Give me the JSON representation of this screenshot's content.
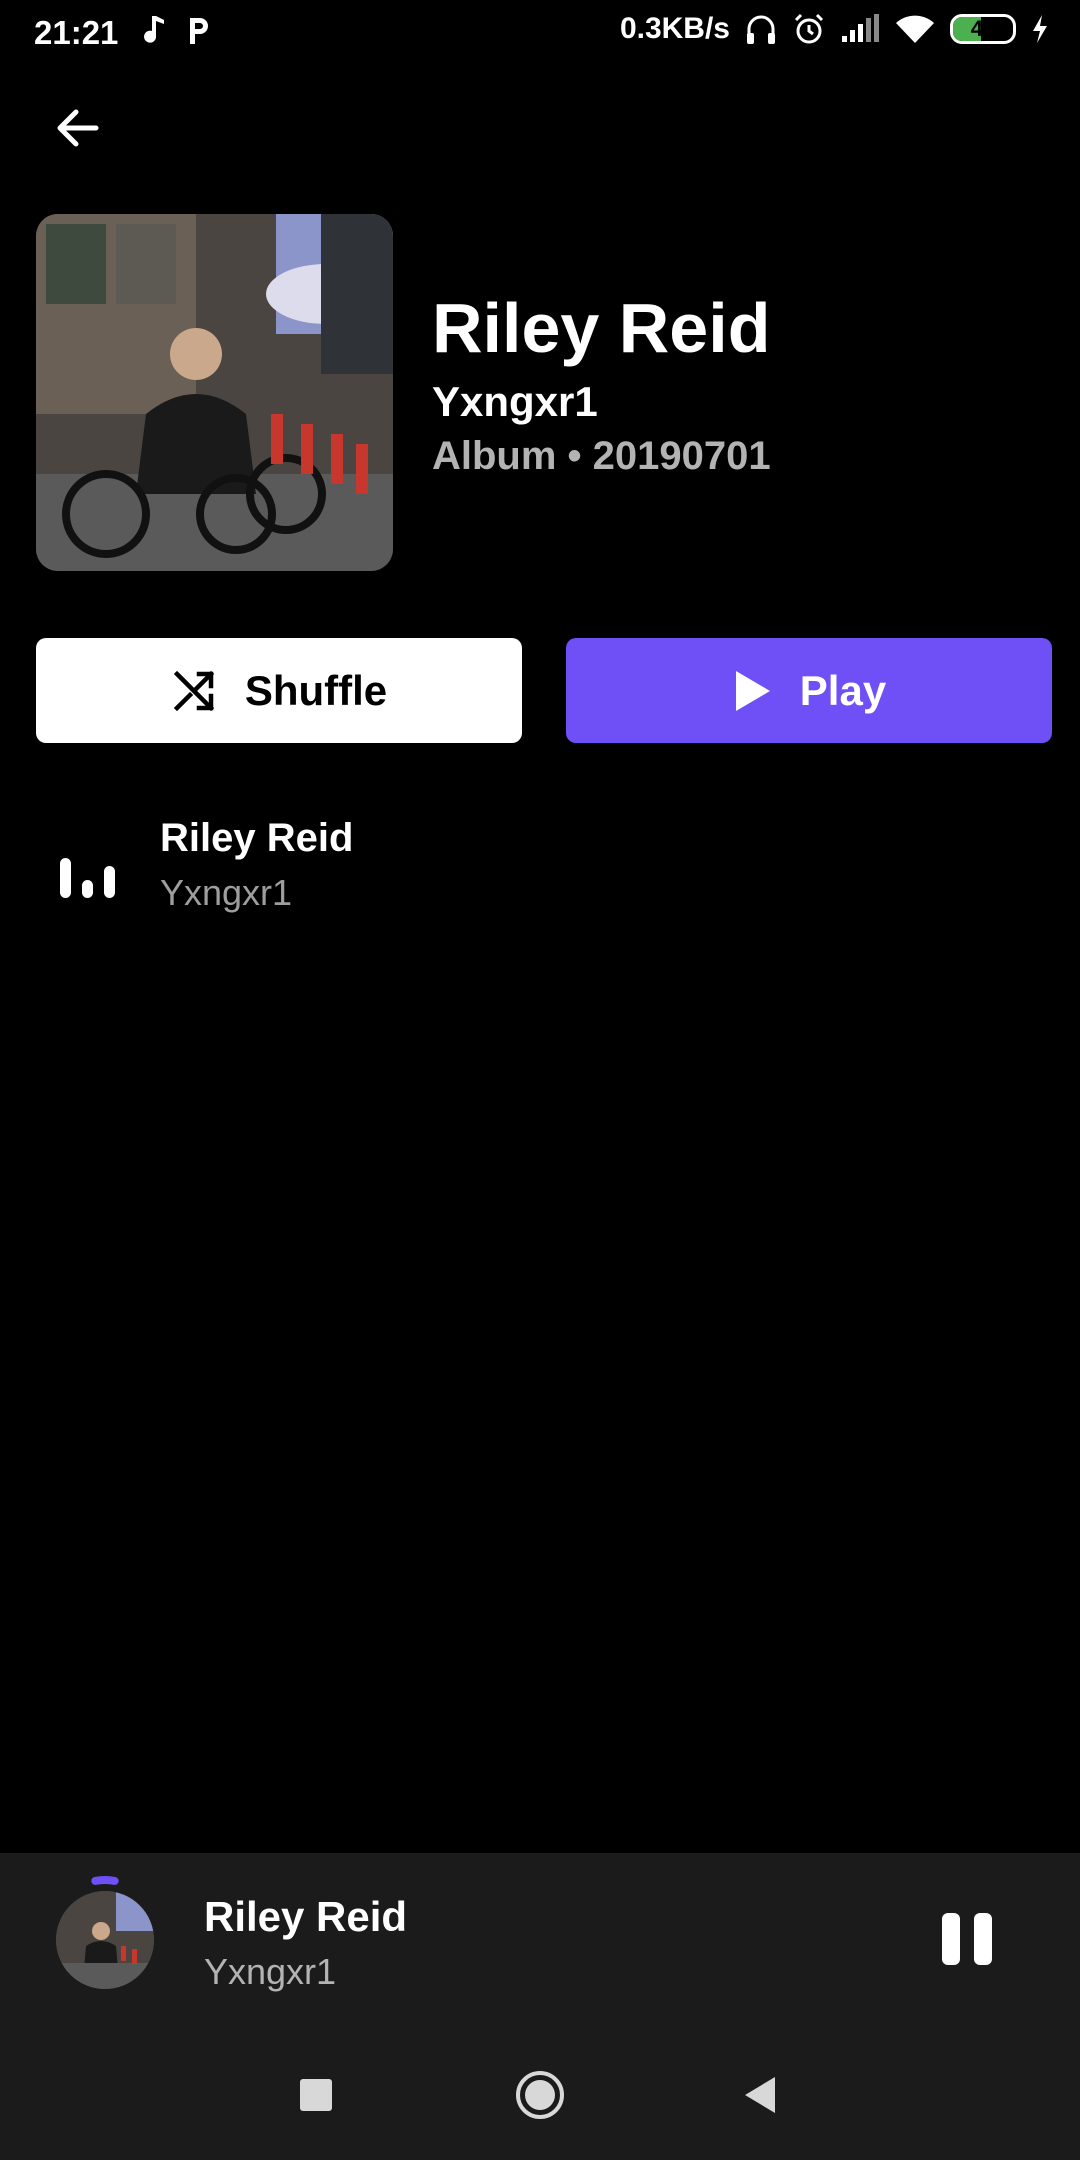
{
  "status_bar": {
    "time": "21:21",
    "net_speed": "0.3KB/s",
    "battery": "46",
    "battery_level_percent": 46,
    "icons": [
      "music-note-icon",
      "p-app-icon",
      "headphones-icon",
      "alarm-icon",
      "signal-icon",
      "wifi-icon",
      "battery-icon",
      "charging-icon"
    ]
  },
  "header": {
    "back_icon": "arrow-left-icon"
  },
  "album": {
    "title": "Riley Reid",
    "artist": "Yxngxr1",
    "meta": "Album • 20190701"
  },
  "actions": {
    "shuffle_label": "Shuffle",
    "play_label": "Play",
    "accent_color": "#6f4ff6"
  },
  "tracks": [
    {
      "title": "Riley Reid",
      "artist": "Yxngxr1",
      "playing": true
    }
  ],
  "mini_player": {
    "title": "Riley Reid",
    "artist": "Yxngxr1",
    "progress_fraction": 0.06
  },
  "nav": {
    "icons": [
      "recents-square-icon",
      "home-circle-icon",
      "back-triangle-icon"
    ]
  }
}
